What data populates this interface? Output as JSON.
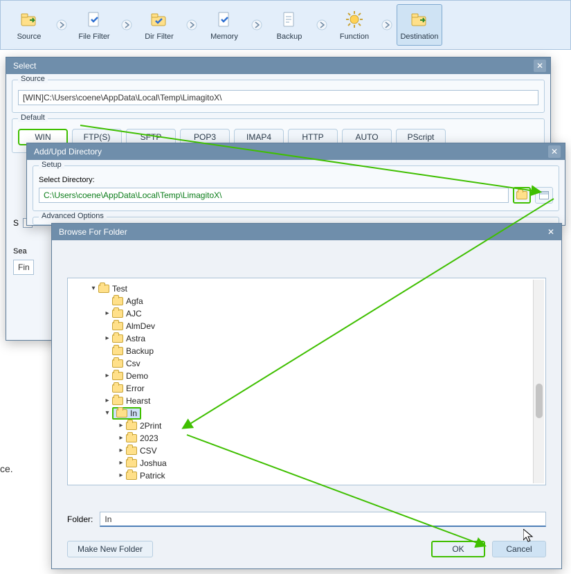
{
  "toolbar": {
    "items": [
      {
        "label": "Source",
        "icon": "folder-go-icon"
      },
      {
        "label": "File Filter",
        "icon": "file-check-icon"
      },
      {
        "label": "Dir Filter",
        "icon": "folder-check-icon"
      },
      {
        "label": "Memory",
        "icon": "file-check-icon"
      },
      {
        "label": "Backup",
        "icon": "file-icon"
      },
      {
        "label": "Function",
        "icon": "gear-icon"
      },
      {
        "label": "Destination",
        "icon": "folder-go-icon"
      }
    ]
  },
  "select_dialog": {
    "title": "Select",
    "source_group": "Source",
    "source_value": "[WIN]C:\\Users\\coene\\AppData\\Local\\Temp\\LimagitoX\\",
    "default_group": "Default",
    "tabs": [
      "WIN",
      "FTP(S)",
      "SFTP",
      "POP3",
      "IMAP4",
      "HTTP",
      "AUTO",
      "PScript"
    ],
    "selected_tab_index": 0,
    "s_checkbox_label": "S",
    "sea_label": "Sea",
    "fin_value": "Fin",
    "truncated_text": "ce."
  },
  "addupd_dialog": {
    "title": "Add/Upd Directory",
    "setup_group": "Setup",
    "select_dir_label": "Select Directory:",
    "dir_value": "C:\\Users\\coene\\AppData\\Local\\Temp\\LimagitoX\\",
    "advanced_group": "Advanced  Options"
  },
  "browse_dialog": {
    "title": "Browse For Folder",
    "tree": [
      {
        "label": "Test",
        "indent": 0,
        "expander": "▾",
        "selected": false
      },
      {
        "label": "Agfa",
        "indent": 1,
        "expander": "",
        "selected": false
      },
      {
        "label": "AJC",
        "indent": 1,
        "expander": "▸",
        "selected": false
      },
      {
        "label": "AlmDev",
        "indent": 1,
        "expander": "",
        "selected": false
      },
      {
        "label": "Astra",
        "indent": 1,
        "expander": "▸",
        "selected": false
      },
      {
        "label": "Backup",
        "indent": 1,
        "expander": "",
        "selected": false
      },
      {
        "label": "Csv",
        "indent": 1,
        "expander": "",
        "selected": false
      },
      {
        "label": "Demo",
        "indent": 1,
        "expander": "▸",
        "selected": false
      },
      {
        "label": "Error",
        "indent": 1,
        "expander": "",
        "selected": false
      },
      {
        "label": "Hearst",
        "indent": 1,
        "expander": "▸",
        "selected": false
      },
      {
        "label": "In",
        "indent": 1,
        "expander": "▾",
        "selected": true
      },
      {
        "label": "2Print",
        "indent": 2,
        "expander": "▸",
        "selected": false
      },
      {
        "label": "2023",
        "indent": 2,
        "expander": "▸",
        "selected": false
      },
      {
        "label": "CSV",
        "indent": 2,
        "expander": "▸",
        "selected": false
      },
      {
        "label": "Joshua",
        "indent": 2,
        "expander": "▸",
        "selected": false
      },
      {
        "label": "Patrick",
        "indent": 2,
        "expander": "▸",
        "selected": false
      }
    ],
    "folder_label": "Folder:",
    "folder_value": "In",
    "make_new": "Make New Folder",
    "ok": "OK",
    "cancel": "Cancel"
  },
  "colors": {
    "highlight_green": "#3fbf00",
    "accent_blue": "#6f8eab"
  }
}
